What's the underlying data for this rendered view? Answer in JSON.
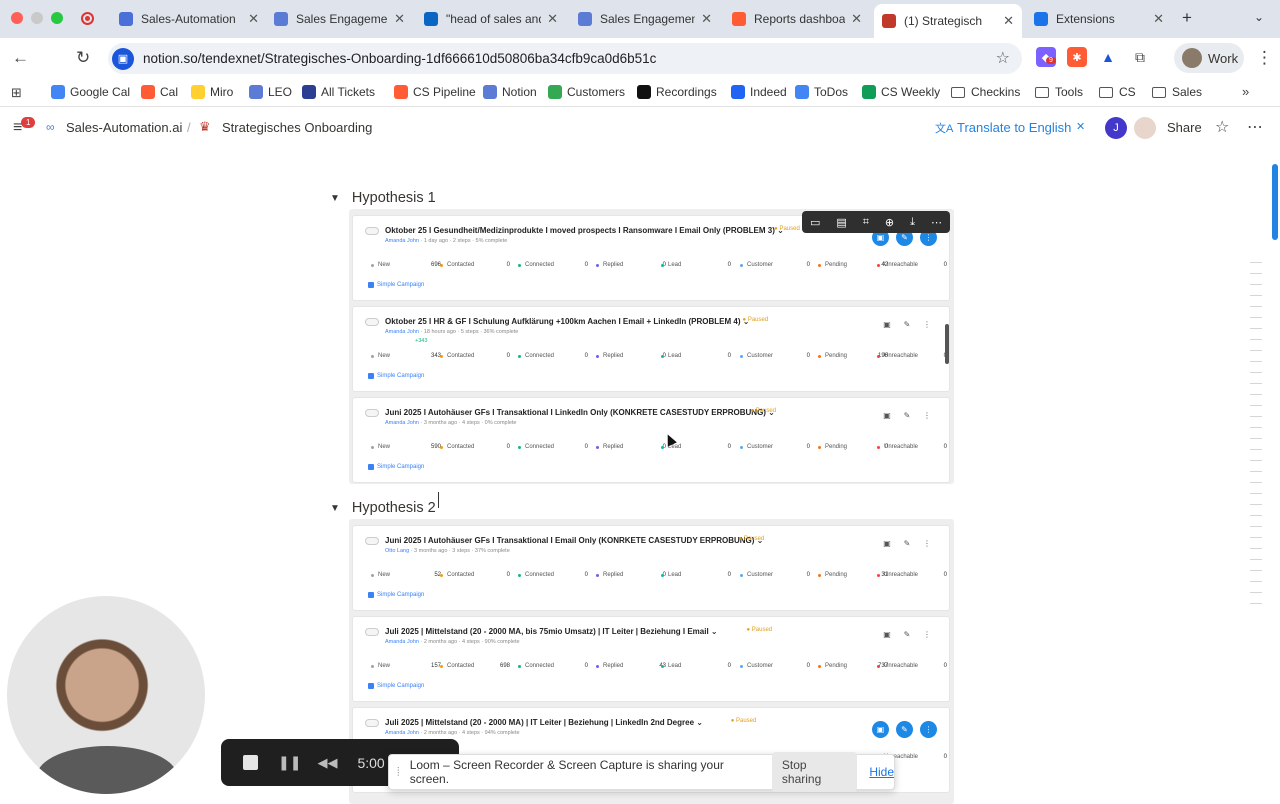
{
  "browser": {
    "tabs": [
      {
        "title": "Sales-Automation",
        "color": "#4a6fd8",
        "icon": "calendar-icon"
      },
      {
        "title": "Sales Engagement",
        "color": "#5b7bd5",
        "icon": "infinity-icon"
      },
      {
        "title": "\"head of sales and",
        "color": "#0a66c2",
        "icon": "linkedin-icon"
      },
      {
        "title": "Sales Engagement",
        "color": "#5b7bd5",
        "icon": "infinity-icon"
      },
      {
        "title": "Reports dashboard",
        "color": "#ff5c35",
        "icon": "hubspot-icon"
      },
      {
        "title": "(1) Strategisch",
        "color": "#c0392b",
        "icon": "crown-icon",
        "active": true
      },
      {
        "title": "Extensions",
        "color": "#1a73e8",
        "icon": "puzzle-icon"
      }
    ],
    "url": "notion.so/tendexnet/Strategisches-Onboarding-1df666610d50806ba34cfb9ca0d6b51c",
    "profile_label": "Work",
    "ext_badge": "9",
    "bookmarks": [
      {
        "label": "Google Cal",
        "color": "#4285f4",
        "type": "app"
      },
      {
        "label": "Cal",
        "color": "#ff5c35",
        "type": "app"
      },
      {
        "label": "Miro",
        "color": "#ffd02f",
        "type": "app"
      },
      {
        "label": "LEO",
        "color": "#5b7bd5",
        "type": "app"
      },
      {
        "label": "All Tickets",
        "color": "#2c3e91",
        "type": "app"
      },
      {
        "label": "CS Pipeline",
        "color": "#ff5c35",
        "type": "app"
      },
      {
        "label": "Notion",
        "color": "#5b7bd5",
        "type": "app"
      },
      {
        "label": "Customers",
        "color": "#34a853",
        "type": "app"
      },
      {
        "label": "Recordings",
        "color": "#111111",
        "type": "app"
      },
      {
        "label": "Indeed",
        "color": "#2164f3",
        "type": "app"
      },
      {
        "label": "ToDos",
        "color": "#4285f4",
        "type": "app"
      },
      {
        "label": "CS Weekly",
        "color": "#0f9d58",
        "type": "app"
      },
      {
        "label": "Checkins",
        "type": "folder"
      },
      {
        "label": "Tools",
        "type": "folder"
      },
      {
        "label": "CS",
        "type": "folder"
      },
      {
        "label": "Sales",
        "type": "folder"
      }
    ]
  },
  "notion": {
    "menu_badge": "1",
    "breadcrumb_workspace": "Sales-Automation.ai",
    "breadcrumb_page": "Strategisches Onboarding",
    "translate_label": "Translate to English",
    "user_initial": "J",
    "share_label": "Share"
  },
  "hypotheses": [
    {
      "title": "Hypothesis 1",
      "campaigns": [
        {
          "title": "Oktober 25 I Gesundheit/Medizinprodukte I moved prospects I Ransomware I Email Only (PROBLEM 3) ⌄",
          "status": "Paused",
          "owner": "Amanda John",
          "meta": " · 1 day ago · 2 steps · 5% complete",
          "badge": "",
          "stats": [
            "696",
            "0",
            "0",
            "0",
            "0",
            "0",
            "42",
            "0"
          ],
          "blue_icons": true
        },
        {
          "title": "Oktober 25 I HR & GF I Schulung Aufklärung +100km Aachen I Email + LinkedIn (PROBLEM 4) ⌄",
          "status": "Paused",
          "owner": "Amanda John",
          "meta": " · 18 hours ago · 5 steps · 36% complete",
          "badge": "+343",
          "stats": [
            "343",
            "0",
            "0",
            "0",
            "0",
            "0",
            "196",
            "0"
          ],
          "blue_icons": false
        },
        {
          "title": "Juni 2025 I Autohäuser GFs I Transaktional I LinkedIn Only (KONKRETE CASESTUDY ERPROBUNG) ⌄",
          "status": "Paused",
          "owner": "Amanda John",
          "meta": " · 3 months ago · 4 steps · 0% complete",
          "badge": "",
          "stats": [
            "590",
            "0",
            "0",
            "0",
            "0",
            "0",
            "0",
            "0"
          ],
          "blue_icons": false
        }
      ]
    },
    {
      "title": "Hypothesis 2",
      "campaigns": [
        {
          "title": "Juni 2025 I Autohäuser GFs I Transaktional I Email Only (KONRKETE CASESTUDY ERPROBUNG) ⌄",
          "status": "Paused",
          "owner": "Otto Lang",
          "meta": " · 3 months ago · 3 steps · 37% complete",
          "badge": "",
          "stats": [
            "52",
            "0",
            "0",
            "0",
            "0",
            "0",
            "31",
            "0"
          ],
          "blue_icons": false
        },
        {
          "title": "Juli 2025 | Mittelstand (20 - 2000 MA, bis 75mio Umsatz) | IT Leiter | Beziehung I Email ⌄",
          "status": "Paused",
          "owner": "Amanda John",
          "meta": " · 2 months ago · 4 steps · 90% complete",
          "badge": "",
          "stats": [
            "157",
            "698",
            "0",
            "43",
            "0",
            "0",
            "737",
            "0"
          ],
          "blue_icons": false
        },
        {
          "title": "Juli 2025 | Mittelstand (20 - 2000 MA) | IT Leiter | Beziehung | LinkedIn 2nd Degree ⌄",
          "status": "Paused",
          "owner": "Amanda John",
          "meta": " · 2 months ago · 4 steps · 94% complete",
          "badge": "",
          "stats": [
            "",
            "",
            "",
            "",
            "",
            "",
            "",
            "0"
          ],
          "blue_icons": true
        }
      ]
    }
  ],
  "stat_labels": [
    "New",
    "Contacted",
    "Connected",
    "Replied",
    "Lead",
    "Customer",
    "Pending",
    "Unreachable"
  ],
  "stat_colors": [
    "#9ca3af",
    "#f59e0b",
    "#10b981",
    "#6366f1",
    "#14b8a6",
    "#60a5fa",
    "#f97316",
    "#ef4444"
  ],
  "campaign_type": "Simple Campaign",
  "loom": {
    "timer": "5:00",
    "share_text": "Loom – Screen Recorder & Screen Capture is sharing your screen.",
    "stop_label": "Stop sharing",
    "hide_label": "Hide"
  }
}
